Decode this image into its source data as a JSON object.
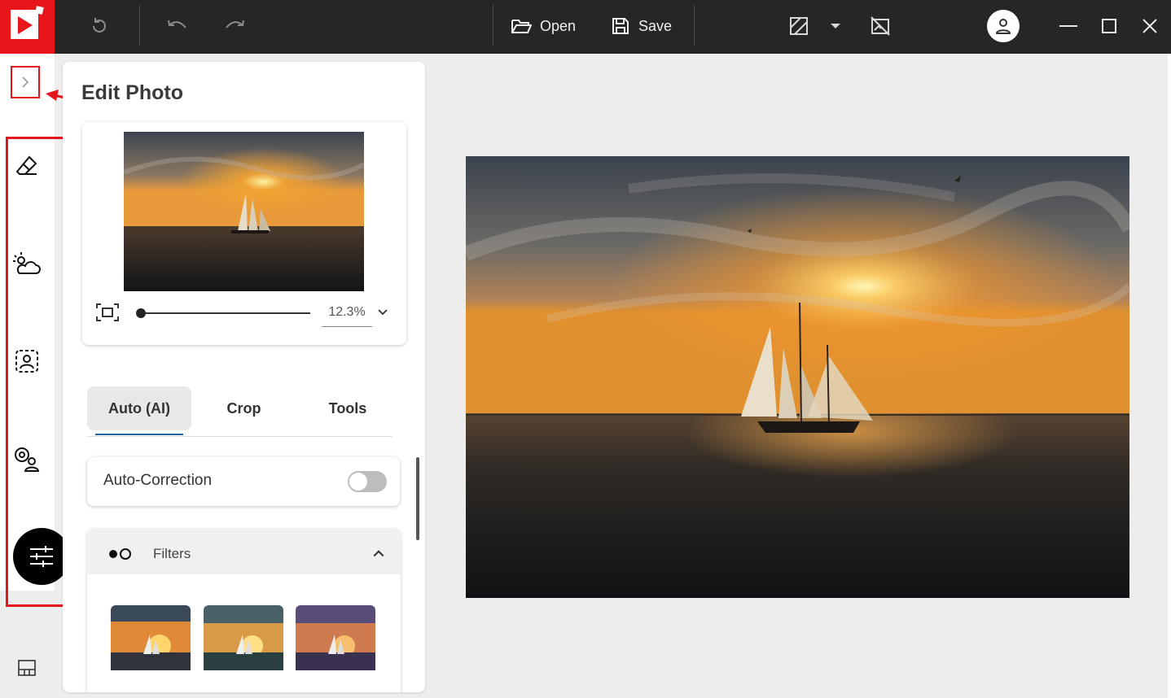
{
  "toolbar": {
    "open_label": "Open",
    "save_label": "Save"
  },
  "panel": {
    "title": "Edit Photo",
    "zoom_value": "12.3%",
    "zoom_fraction": 0.0
  },
  "tabs": [
    {
      "label": "Auto (AI)",
      "active": true
    },
    {
      "label": "Crop",
      "active": false
    },
    {
      "label": "Tools",
      "active": false
    }
  ],
  "auto_correction": {
    "label": "Auto-Correction",
    "enabled": false
  },
  "filters": {
    "label": "Filters"
  },
  "colors": {
    "brand": "#e8151b",
    "titlebar": "#262626",
    "highlight": "#e5161b",
    "tab_underline": "#1f5fa8"
  },
  "icons": [
    "app-logo-icon",
    "reset-icon",
    "undo-icon",
    "redo-icon",
    "folder-open-icon",
    "save-icon",
    "compare-icon",
    "chevron-down-icon",
    "crop-off-icon",
    "user-icon",
    "minimize-icon",
    "maximize-icon",
    "close-icon",
    "chevron-right-icon",
    "eraser-icon",
    "sky-icon",
    "portrait-icon",
    "face-swap-icon",
    "sliders-icon",
    "layout-icon",
    "fit-screen-icon",
    "filters-icon",
    "chevron-up-icon"
  ]
}
